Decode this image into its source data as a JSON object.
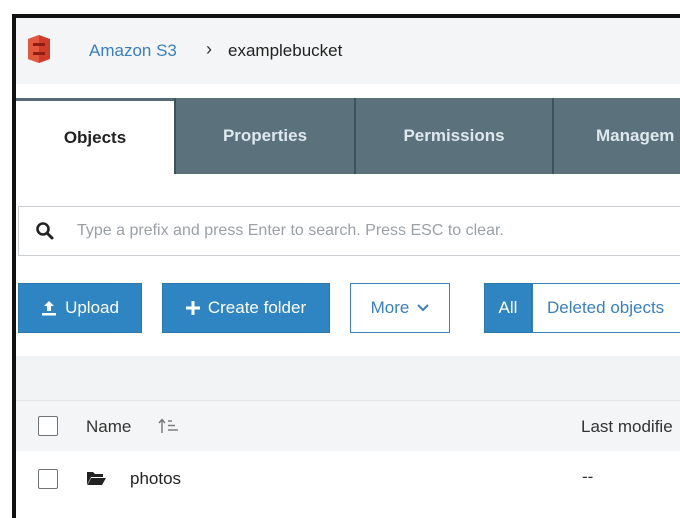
{
  "breadcrumb": {
    "service": "Amazon S3",
    "separator": "›",
    "bucket": "examplebucket"
  },
  "tabs": [
    {
      "label": "Objects",
      "active": true
    },
    {
      "label": "Properties",
      "active": false
    },
    {
      "label": "Permissions",
      "active": false
    },
    {
      "label": "Managem",
      "active": false
    }
  ],
  "search": {
    "placeholder": "Type a prefix and press Enter to search. Press ESC to clear.",
    "value": ""
  },
  "toolbar": {
    "upload_label": "Upload",
    "create_folder_label": "Create folder",
    "more_label": "More",
    "filter_all_label": "All",
    "filter_deleted_label": "Deleted objects"
  },
  "table": {
    "columns": {
      "name": "Name",
      "last_modified": "Last modifie"
    },
    "rows": [
      {
        "type": "folder",
        "name": "photos",
        "last_modified": "--"
      }
    ]
  },
  "colors": {
    "accent": "#2f84c2",
    "tab_bg": "#5b717c",
    "link": "#3a7fbf",
    "logo": "#d13b2a"
  },
  "icons": [
    "s3-logo-icon",
    "search-icon",
    "upload-icon",
    "plus-icon",
    "chevron-down-icon",
    "sort-icon",
    "folder-icon"
  ]
}
